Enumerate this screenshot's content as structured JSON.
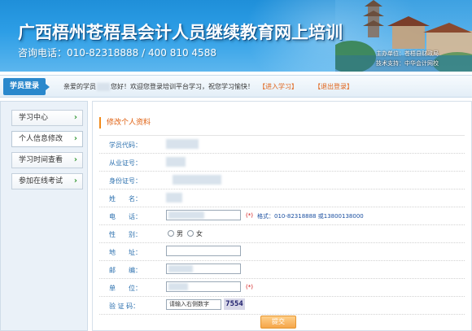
{
  "header": {
    "title": "广西梧州苍梧县会计人员继续教育网上培训",
    "phone": "咨询电话：010-82318888 / 400 810 4588",
    "org_host": "主办单位：苍梧县财政局",
    "org_tech": "技术支持：中华会计网校"
  },
  "infobar": {
    "tag": "学员登录",
    "welcome_prefix": "亲爱的学员",
    "welcome_suffix": "您好！欢迎您登录培训平台学习，祝您学习愉快！",
    "enter_label": "【进入学习】",
    "exit_label": "【退出登录】"
  },
  "sidebar": {
    "items": [
      {
        "label": "学习中心"
      },
      {
        "label": "个人信息修改"
      },
      {
        "label": "学习时间查看"
      },
      {
        "label": "参加在线考试"
      }
    ]
  },
  "form": {
    "section_title": "修改个人资料",
    "labels": {
      "student_code": "学员代码：",
      "cert_no": "从业证号：",
      "id_no": "身份证号：",
      "name": "姓　　名：",
      "phone": "电　　话：",
      "gender": "性　　别：",
      "address": "地　　址：",
      "postcode": "邮　　编：",
      "unit": "单　　位：",
      "captcha": "验 证 码："
    },
    "required_mark": "(*)",
    "phone_hint": "格式：010-82318888 或13800138000",
    "gender_options": [
      "男",
      "女"
    ],
    "captcha_placeholder": "请输入右侧数字",
    "captcha_code": "7554",
    "submit_label": "提交"
  },
  "colors": {
    "banner_blue": "#2d9ee6",
    "accent_orange": "#e0641a",
    "label_blue": "#2a6fae",
    "required_red": "#d01010"
  }
}
